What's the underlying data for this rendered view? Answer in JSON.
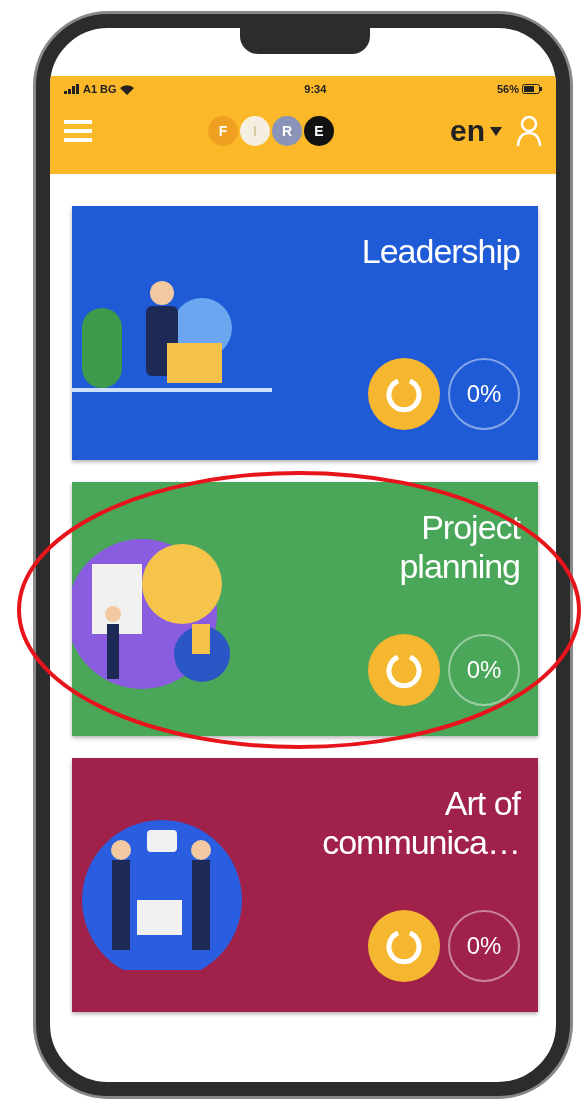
{
  "status_bar": {
    "carrier": "A1 BG",
    "time": "9:34",
    "battery": "56%"
  },
  "header": {
    "logo_letters": [
      "F",
      "I",
      "R",
      "E"
    ],
    "language": "en"
  },
  "cards": [
    {
      "title": "Leadership",
      "progress": "0%",
      "color": "#1f5bd6",
      "circled": false
    },
    {
      "title": "Project planning",
      "progress": "0%",
      "color": "#4aa658",
      "circled": true
    },
    {
      "title": "Art of communica…",
      "progress": "0%",
      "color": "#a0214a",
      "circled": false
    }
  ]
}
